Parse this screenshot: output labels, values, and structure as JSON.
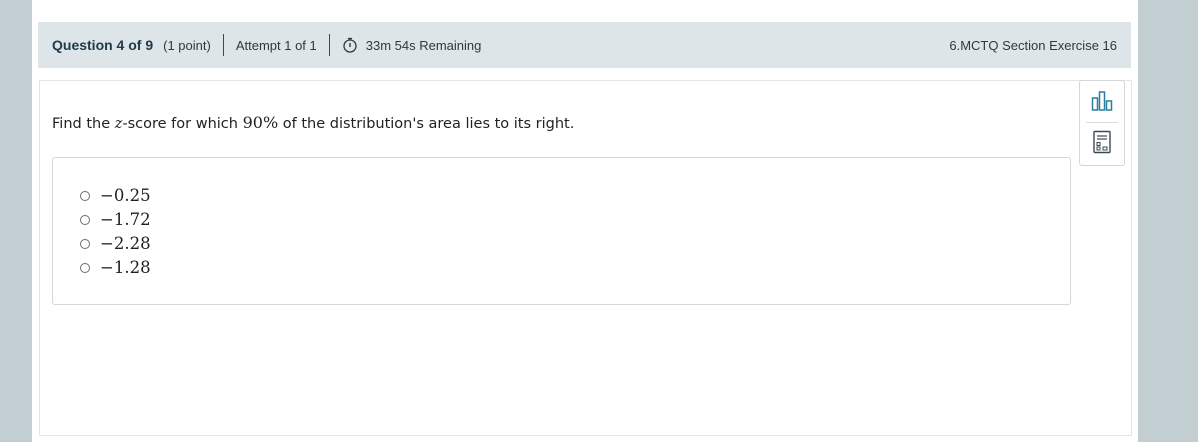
{
  "header": {
    "question_label": "Question 4 of 9",
    "points": "(1 point)",
    "attempt": "Attempt 1 of 1",
    "time_remaining": "33m 54s Remaining",
    "exercise_title": "6.MCTQ Section Exercise 16"
  },
  "question": {
    "prefix": "Find the ",
    "variable": "z",
    "middle": "-score for which ",
    "percent": "90%",
    "suffix": " of the distribution's area lies to its right."
  },
  "options": [
    {
      "label": "−0.25"
    },
    {
      "label": "−1.72"
    },
    {
      "label": "−2.28"
    },
    {
      "label": "−1.28"
    }
  ],
  "tools": {
    "top_icon": "bar-chart-icon",
    "bottom_icon": "calculator-icon"
  },
  "colors": {
    "accent": "#2a7d9c",
    "header_bg": "#dde5e8",
    "side_bg": "#c3ced3"
  }
}
